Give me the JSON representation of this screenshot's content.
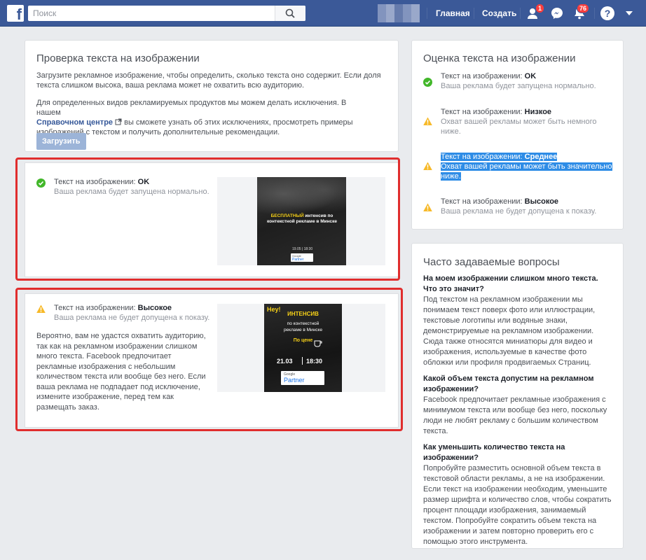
{
  "topbar": {
    "logo": "f",
    "search_placeholder": "Поиск",
    "nav_home": "Главная",
    "nav_create": "Создать",
    "friends_badge": "1",
    "notifications_badge": "76",
    "help": "?"
  },
  "check_card": {
    "title": "Проверка текста на изображении",
    "para1": "Загрузите рекламное изображение, чтобы определить, сколько текста оно содержит. Если доля текста слишком высока, ваша реклама может не охватить всю аудиторию.",
    "para2_before": "Для определенных видов рекламируемых продуктов мы можем делать исключения. В нашем",
    "para2_link": "Справочном центре",
    "para2_after": "вы сможете узнать об этих исключениях, просмотреть примеры изображений с текстом и получить дополнительные рекомендации.",
    "upload_button": "Загрузить"
  },
  "result_ok": {
    "label": "Текст на изображении: ",
    "rating": "OK",
    "sub": "Ваша реклама будет запущена нормально.",
    "ad": {
      "headline_yellow": "БЕСПЛАТНЫЙ",
      "headline_rest": " интенсив по контекстной рекламе в Минске",
      "date": "19.05 | 18:30",
      "partner_small": "Google",
      "partner": "Partner"
    }
  },
  "result_high": {
    "label": "Текст на изображении: ",
    "rating": "Высокое",
    "sub": "Ваша реклама не будет допущена к показу.",
    "body": "Вероятно, вам не удастся охватить аудиторию, так как на рекламном изображении слишком много текста. Facebook предпочитает рекламные изображения с небольшим количеством текста или вообще без него. Если ваша реклама не подпадает под исключение, измените изображение, перед тем как размещать заказ.",
    "ad": {
      "hey": "Hey!",
      "title": "ИНТЕНСИВ",
      "line1": "по контекстной",
      "line2": "рекламе в Минске",
      "price": "По цене",
      "date": "21.03",
      "time": "18:30",
      "partner_small": "Google",
      "partner": "Partner"
    }
  },
  "rating_card": {
    "title": "Оценка текста на изображении",
    "items": [
      {
        "label": "Текст на изображении: ",
        "rating": "OK",
        "sub": "Ваша реклама будет запущена нормально."
      },
      {
        "label": "Текст на изображении: ",
        "rating": "Низкое",
        "sub": "Охват вашей рекламы может быть немного ниже."
      },
      {
        "label": "Текст на изображении: ",
        "rating": "Среднее",
        "sub": "Охват вашей рекламы может быть значительно ниже."
      },
      {
        "label": "Текст на изображении: ",
        "rating": "Высокое",
        "sub": "Ваша реклама не будет допущена к показу."
      }
    ]
  },
  "faq_card": {
    "title": "Часто задаваемые вопросы",
    "items": [
      {
        "q": "На моем изображении слишком много текста. Что это значит?",
        "a": "Под текстом на рекламном изображении мы понимаем текст поверх фото или иллюстрации, текстовые логотипы или водяные знаки, демонстрируемые на рекламном изображении. Сюда также относятся миниатюры для видео и изображения, используемые в качестве фото обложки или профиля продвигаемых Страниц."
      },
      {
        "q": "Какой объем текста допустим на рекламном изображении?",
        "a": "Facebook предпочитает рекламные изображения с минимумом текста или вообще без него, поскольку люди не любят рекламу с большим количеством текста."
      },
      {
        "q": "Как уменьшить количество текста на изображении?",
        "a": "Попробуйте разместить основной объем текста в текстовой области рекламы, а не на изображении. Если текст на изображении необходим, уменьшите размер шрифта и количество слов, чтобы сократить процент площади изображения, занимаемый текстом. Попробуйте сократить объем текста на изображении и затем повторно проверить его с помощью этого инструмента."
      }
    ]
  }
}
